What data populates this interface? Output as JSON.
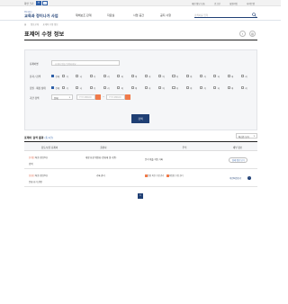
{
  "topbar": {
    "font_size_label": "화면 크기",
    "zoom_in": "+",
    "zoom_out": "−",
    "links": [
      "개인 정보 보호",
      "로그인",
      "회원가입",
      "사이트맵"
    ]
  },
  "header": {
    "logo_small": "Ministry",
    "logo_big": "교육과 정이나가 사업",
    "nav": [
      "재해보조 관계",
      "자료실",
      "사업 공간",
      "공지 사항"
    ],
    "search_placeholder": "검색어를 입력"
  },
  "breadcrumb": [
    "홈",
    "정보공개",
    "표제어 수정 정보"
  ],
  "page": {
    "title": "표제어 수정 정보",
    "tools": [
      "‹",
      "◎"
    ]
  },
  "filter": {
    "keyword_label": "표제어명",
    "keyword_placeholder": "표제어 명을 입력하세요",
    "category_label": "분과 / 검색",
    "type_label": "집필 · 제정 상태",
    "date_label": "기간 검색",
    "all_label": "전체",
    "options_row1": [
      "가",
      "나",
      "다",
      "라",
      "마",
      "바",
      "사",
      "아",
      "자",
      "차",
      "카",
      "타",
      "파",
      "하"
    ],
    "options_row2": [
      "가",
      "나",
      "다",
      "라",
      "마",
      "바",
      "사",
      "아",
      "자",
      "차",
      "카",
      "타",
      "파",
      "하"
    ],
    "date_select": "전체",
    "date_start_placeholder": "YYYY-MM-DD",
    "date_end_placeholder": "YYYY-MM-DD",
    "tilde": "~",
    "search_button": "검색"
  },
  "results": {
    "title": "표제어 검색 결과",
    "count_text": "(총 2건)",
    "sort_value": "최신순 보기",
    "columns": [
      "검토/보류 표제어",
      "출판사",
      "주석",
      "세부 정보"
    ],
    "rows": [
      {
        "tag": "[수정]",
        "word": "최종 (전문어)",
        "sub": "검색",
        "publisher": "개정 요청 위원회 (문화재 및 기준)",
        "note": "문서 제출 학습 기록",
        "action": "상세 정보 보기"
      },
      {
        "tag": "[보류]",
        "word": "최종 (전문어)",
        "sub": "문화 표기 관련",
        "publisher": "기록 관리",
        "status1": "통합 의견 수정 관리",
        "status2": "비통합 수정 관리",
        "action": "이전의견보기"
      }
    ]
  },
  "pagination": {
    "current": "1"
  },
  "colors": {
    "primary": "#1f3f74",
    "accent": "#f07a4a",
    "link": "#2d5fa8"
  }
}
